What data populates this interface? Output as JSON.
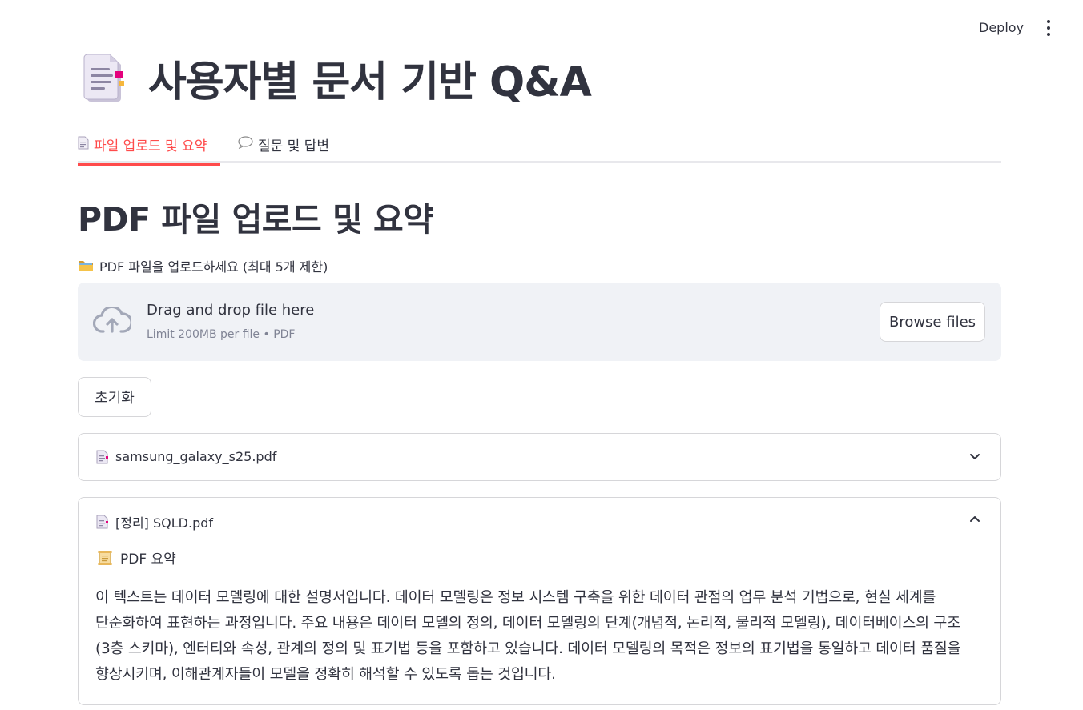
{
  "header": {
    "deploy_label": "Deploy",
    "menu_icon": "more-vertical-icon"
  },
  "app": {
    "title": "사용자별 문서 기반 Q&A",
    "title_icon": "document-icon"
  },
  "tabs": [
    {
      "label": "파일 업로드 및 요약",
      "icon": "document-icon",
      "active": true
    },
    {
      "label": "질문 및 답변",
      "icon": "speech-bubble-icon",
      "active": false
    }
  ],
  "main": {
    "heading": "PDF 파일 업로드 및 요약",
    "uploader": {
      "label": "PDF 파일을 업로드하세요 (최대 5개 제한)",
      "label_icon": "folder-icon",
      "drop_text": "Drag and drop file here",
      "limit_text": "Limit 200MB per file • PDF",
      "browse_label": "Browse files"
    },
    "reset_label": "초기화",
    "files": [
      {
        "name": "samsung_galaxy_s25.pdf",
        "expanded": false
      },
      {
        "name": "[정리] SQLD.pdf",
        "expanded": true,
        "summary_label": "PDF 요약",
        "summary_text": "이 텍스트는 데이터 모델링에 대한 설명서입니다. 데이터 모델링은 정보 시스템 구축을 위한 데이터 관점의 업무 분석 기법으로, 현실 세계를 단순화하여 표현하는 과정입니다. 주요 내용은 데이터 모델의 정의, 데이터 모델링의 단계(개념적, 논리적, 물리적 모델링), 데이터베이스의 구조(3층 스키마), 엔터티와 속성, 관계의 정의 및 표기법 등을 포함하고 있습니다. 데이터 모델링의 목적은 정보의 표기법을 통일하고 데이터 품질을 향상시키며, 이해관계자들이 모델을 정확히 해석할 수 있도록 돕는 것입니다."
      }
    ]
  },
  "colors": {
    "accent": "#ff4b4b",
    "text": "#31333f",
    "muted": "#808495",
    "dropzone_bg": "#f0f2f6",
    "border": "#d6d6d9"
  }
}
